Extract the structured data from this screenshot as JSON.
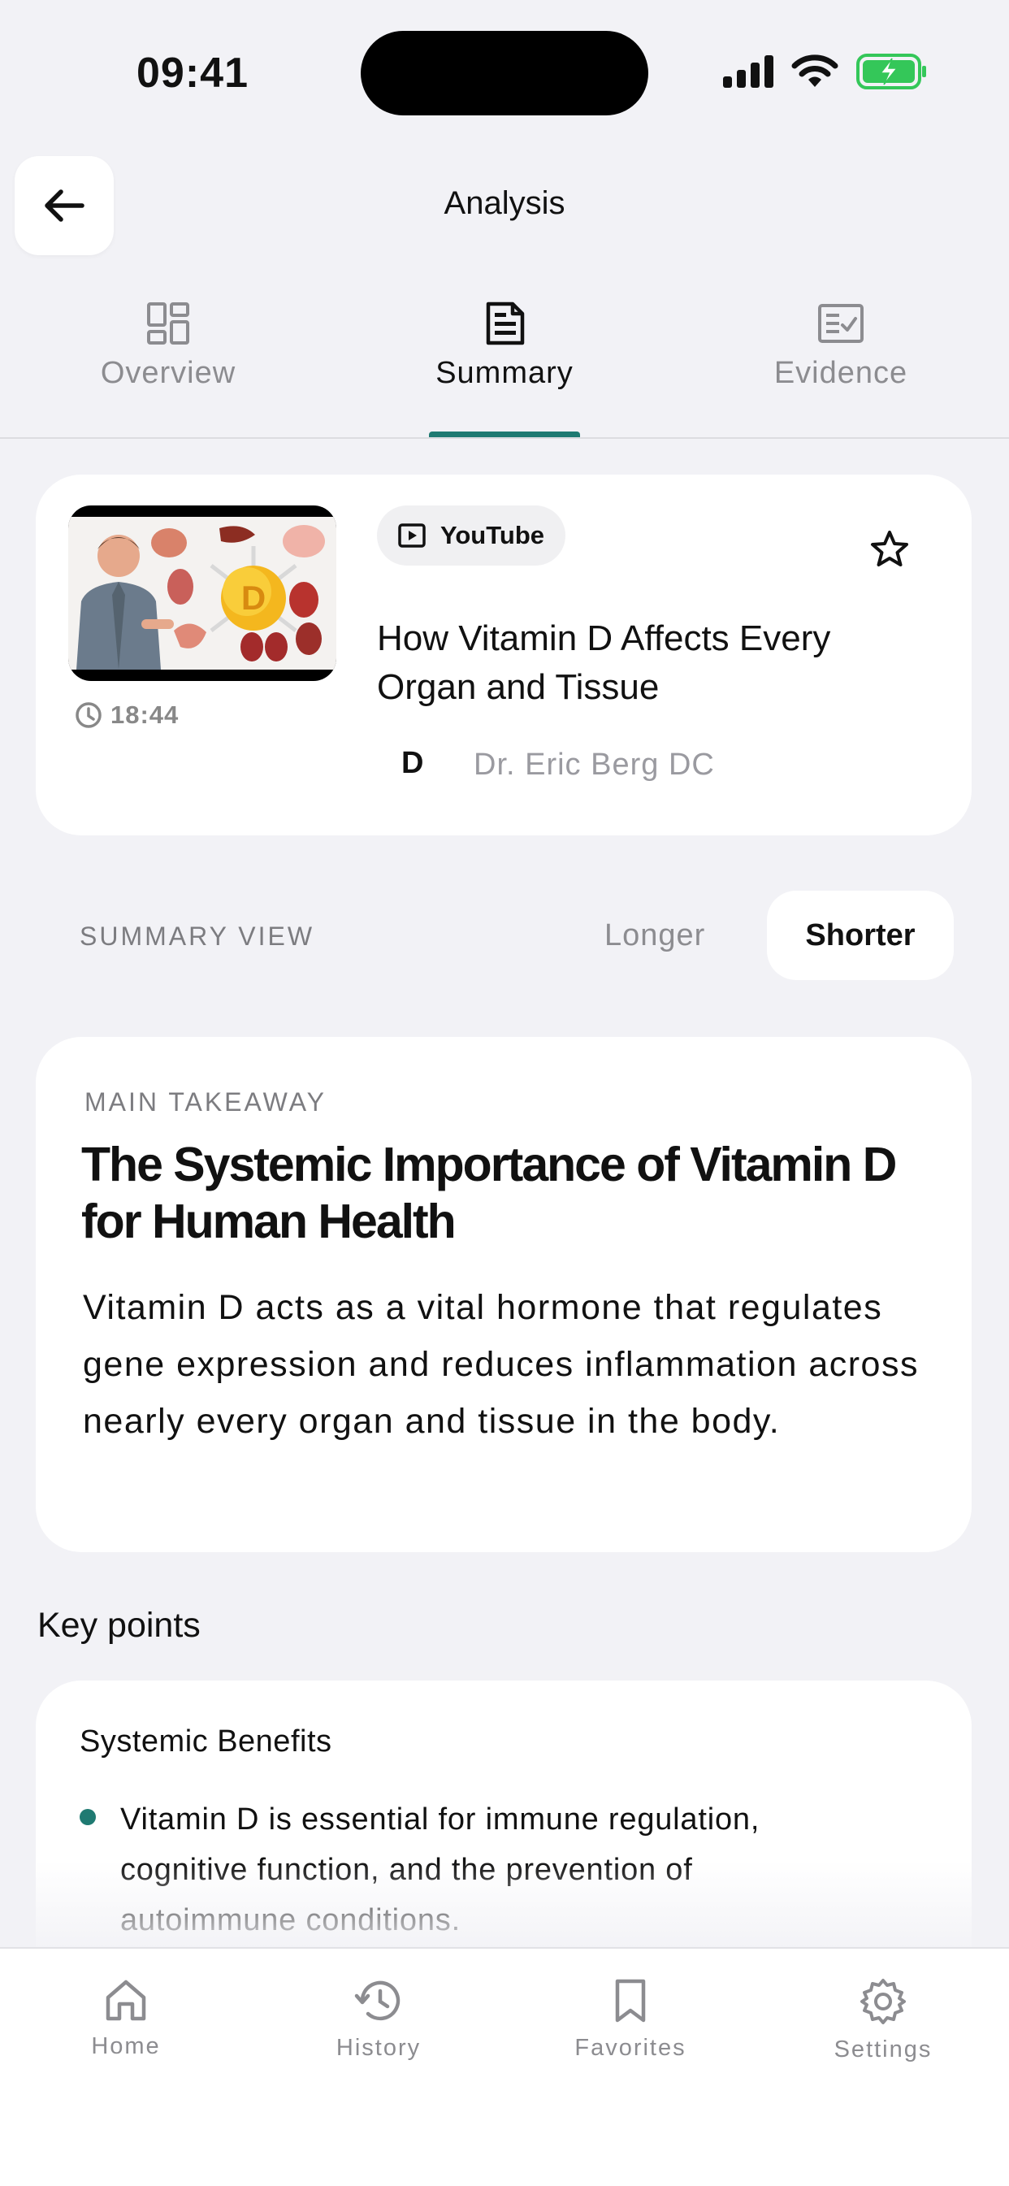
{
  "status_bar": {
    "time": "09:41"
  },
  "header": {
    "title": "Analysis"
  },
  "tabs": [
    {
      "label": "Overview"
    },
    {
      "label": "Summary"
    },
    {
      "label": "Evidence"
    }
  ],
  "video": {
    "source": "YouTube",
    "title": "How Vitamin D Affects Every Organ and Tissue",
    "duration": "18:44",
    "channel_initial": "D",
    "channel": "Dr. Eric Berg DC",
    "thumbnail_badge": "D"
  },
  "summary_view": {
    "label": "SUMMARY VIEW",
    "options": [
      "Longer",
      "Shorter"
    ],
    "selected": "Shorter"
  },
  "main_takeaway": {
    "label": "MAIN TAKEAWAY",
    "title": "The Systemic Importance of Vitamin D for Human Health",
    "body": "Vitamin D acts as a vital hormone that regulates gene expression and reduces inflammation across nearly every organ and tissue in the body."
  },
  "key_points": {
    "heading": "Key points",
    "sections": [
      {
        "title": "Systemic Benefits",
        "items": [
          "Vitamin D is essential for immune regulation, cognitive function, and the prevention of autoimmune conditions."
        ]
      }
    ]
  },
  "tab_bar": [
    {
      "label": "Home",
      "icon": "home-icon"
    },
    {
      "label": "History",
      "icon": "history-icon"
    },
    {
      "label": "Favorites",
      "icon": "bookmark-icon"
    },
    {
      "label": "Settings",
      "icon": "gear-icon"
    }
  ],
  "colors": {
    "accent": "#1f7a72",
    "background": "#f2f2f6",
    "battery": "#34c759"
  }
}
